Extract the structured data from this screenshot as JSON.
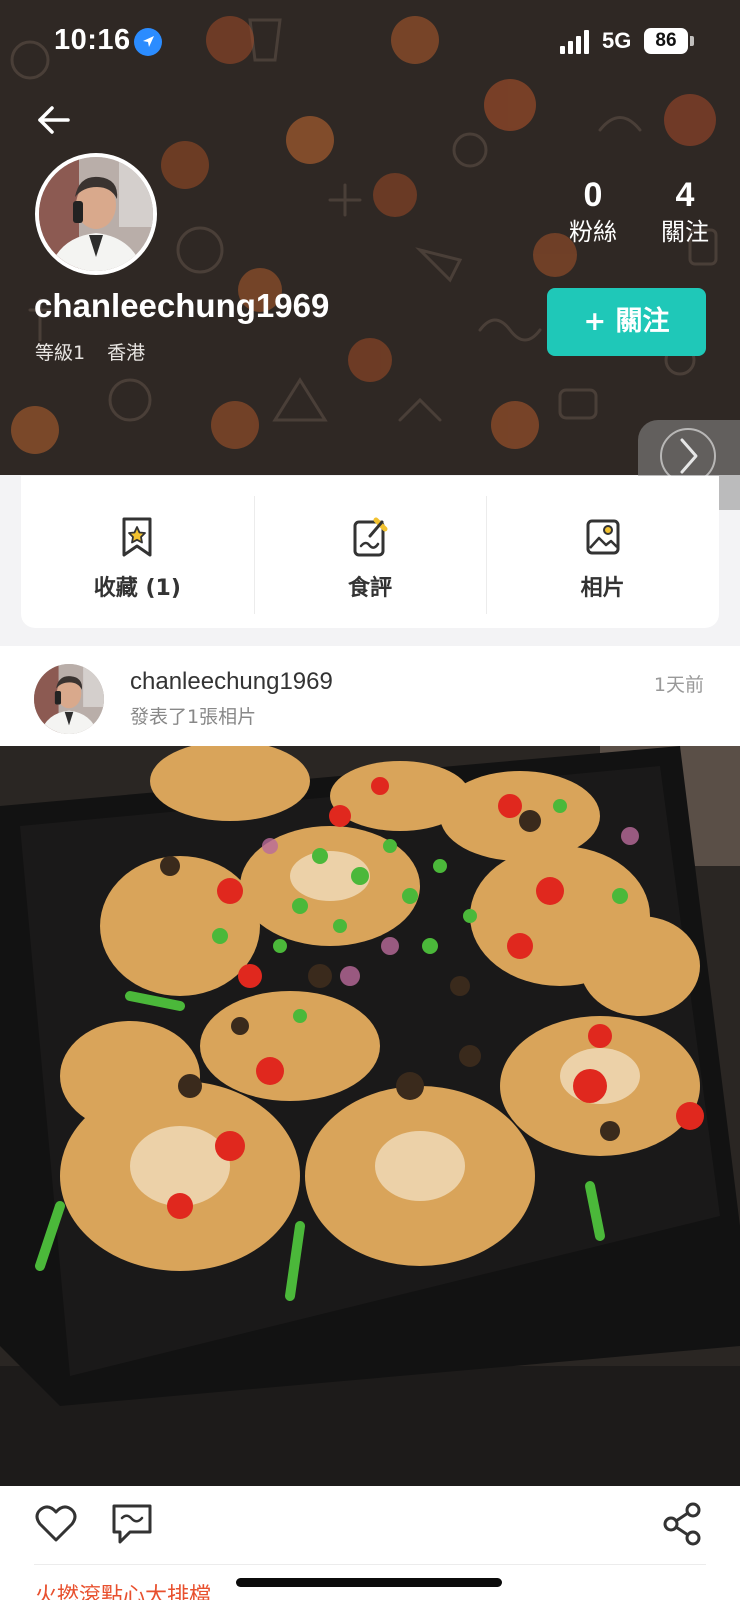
{
  "status_bar": {
    "time": "10:16",
    "network": "5G",
    "battery": "86"
  },
  "profile": {
    "username": "chanleechung1969",
    "level": "等級1",
    "region": "香港",
    "followers_count": "0",
    "followers_label": "粉絲",
    "following_count": "4",
    "following_label": "關注",
    "follow_button": "+ 關注"
  },
  "actions": {
    "bookmarks": "收藏 (1)",
    "reviews": "食評",
    "photos": "相片"
  },
  "post": {
    "username": "chanleechung1969",
    "subtitle": "發表了1張相片",
    "time": "1天前",
    "restaurant": "火撚滾點心大排檔"
  },
  "colors": {
    "header_bg": "#2f2824",
    "accent": "#1fc8b8",
    "link": "#e8502e"
  },
  "icons": {
    "back": "arrow-left-icon",
    "location": "location-arrow-icon",
    "signal": "signal-bars-icon",
    "next": "chevron-right-icon",
    "bookmark": "bookmark-star-icon",
    "review": "edit-note-icon",
    "photo": "photo-album-icon",
    "like": "heart-icon",
    "comment": "comment-icon",
    "share": "share-icon"
  }
}
